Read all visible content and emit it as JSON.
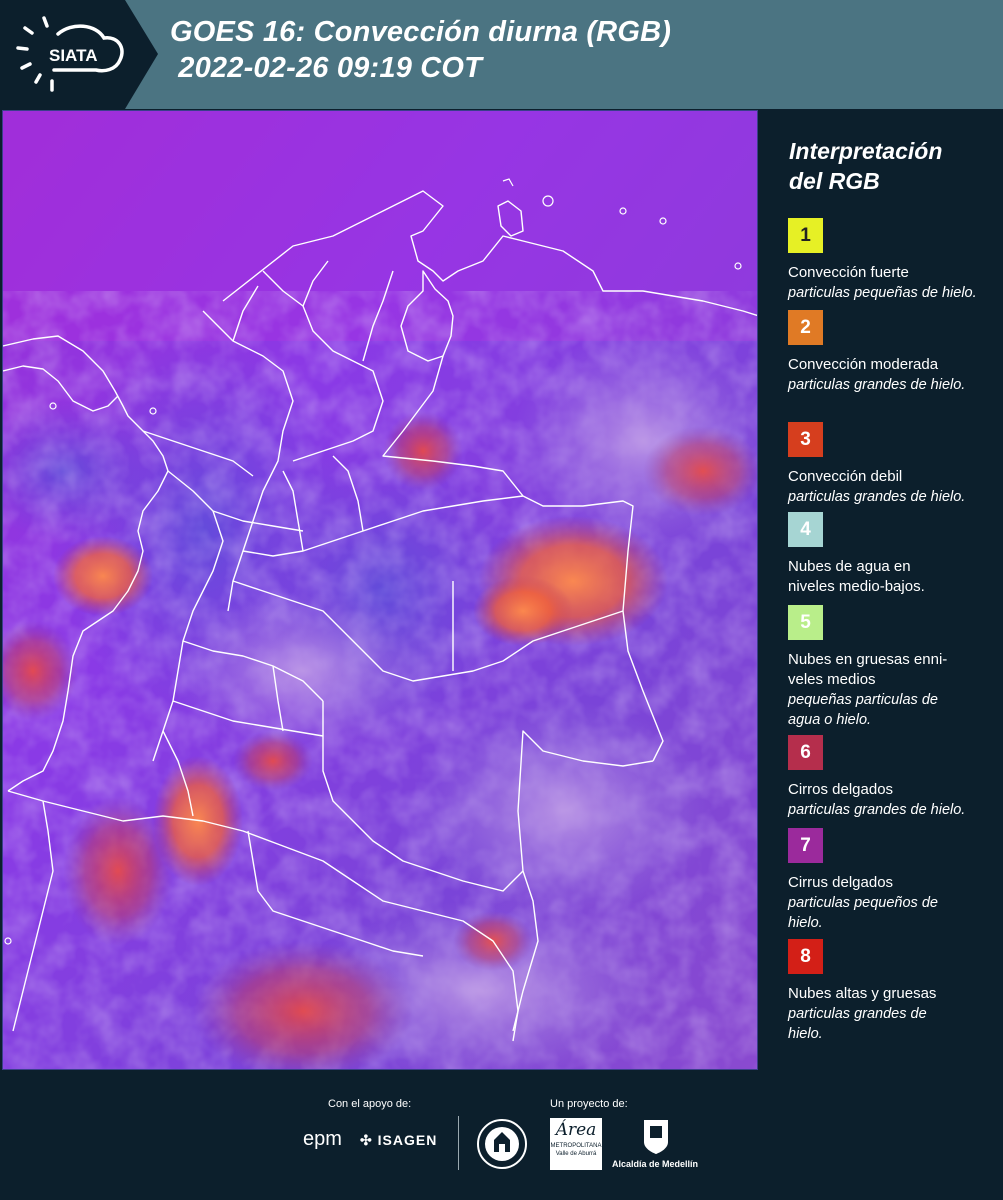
{
  "header": {
    "logo_text": "SIATA",
    "title_line1": "GOES 16: Convección diurna (RGB)",
    "title_line2": " 2022-02-26 09:19 COT"
  },
  "legend": {
    "title_line1": "Interpretación",
    "title_line2": "del RGB",
    "items": [
      {
        "num": "1",
        "color": "#e6f025",
        "num_color": "#222222",
        "name": "Convección fuerte",
        "desc": "particulas pequeñas de hielo."
      },
      {
        "num": "2",
        "color": "#e07a25",
        "num_color": "#ffffff",
        "name": "Convección moderada",
        "desc": "particulas grandes de hielo."
      },
      {
        "num": "3",
        "color": "#d63e1e",
        "num_color": "#ffffff",
        "name": "Convección debil",
        "desc": "particulas grandes de hielo."
      },
      {
        "num": "4",
        "color": "#a6d5d3",
        "num_color": "#ffffff",
        "name": "Nubes de agua en niveles medio-bajos.",
        "desc": ""
      },
      {
        "num": "5",
        "color": "#b9ee8a",
        "num_color": "#ffffff",
        "name": "Nubes en gruesas enni-veles medios",
        "desc": "pequeñas particulas de agua o hielo."
      },
      {
        "num": "6",
        "color": "#b52e4c",
        "num_color": "#ffffff",
        "name": "Cirros delgados",
        "desc": "particulas grandes de hielo."
      },
      {
        "num": "7",
        "color": "#9b2a9c",
        "num_color": "#ffffff",
        "name": "Cirrus delgados",
        "desc": "particulas pequeños de hielo."
      },
      {
        "num": "8",
        "color": "#d31f17",
        "num_color": "#ffffff",
        "name": "Nubes altas y gruesas",
        "desc": "particulas grandes de hielo."
      }
    ]
  },
  "footer": {
    "support_label": "Con el apoyo de:",
    "project_label": "Un proyecto de:",
    "epm": "epm",
    "isagen": "ISAGEN",
    "area_metro": "Área",
    "area_metro_sub": "METROPOLITANA",
    "area_metro_sub2": "Valle de Aburrá",
    "alcaldia": "Alcaldía de Medellín"
  },
  "colors": {
    "header_bg": "#4b7482",
    "logo_bg": "#0c1f2c",
    "page_bg": "#0c1f2c",
    "map_base": "#7a3ae0"
  }
}
